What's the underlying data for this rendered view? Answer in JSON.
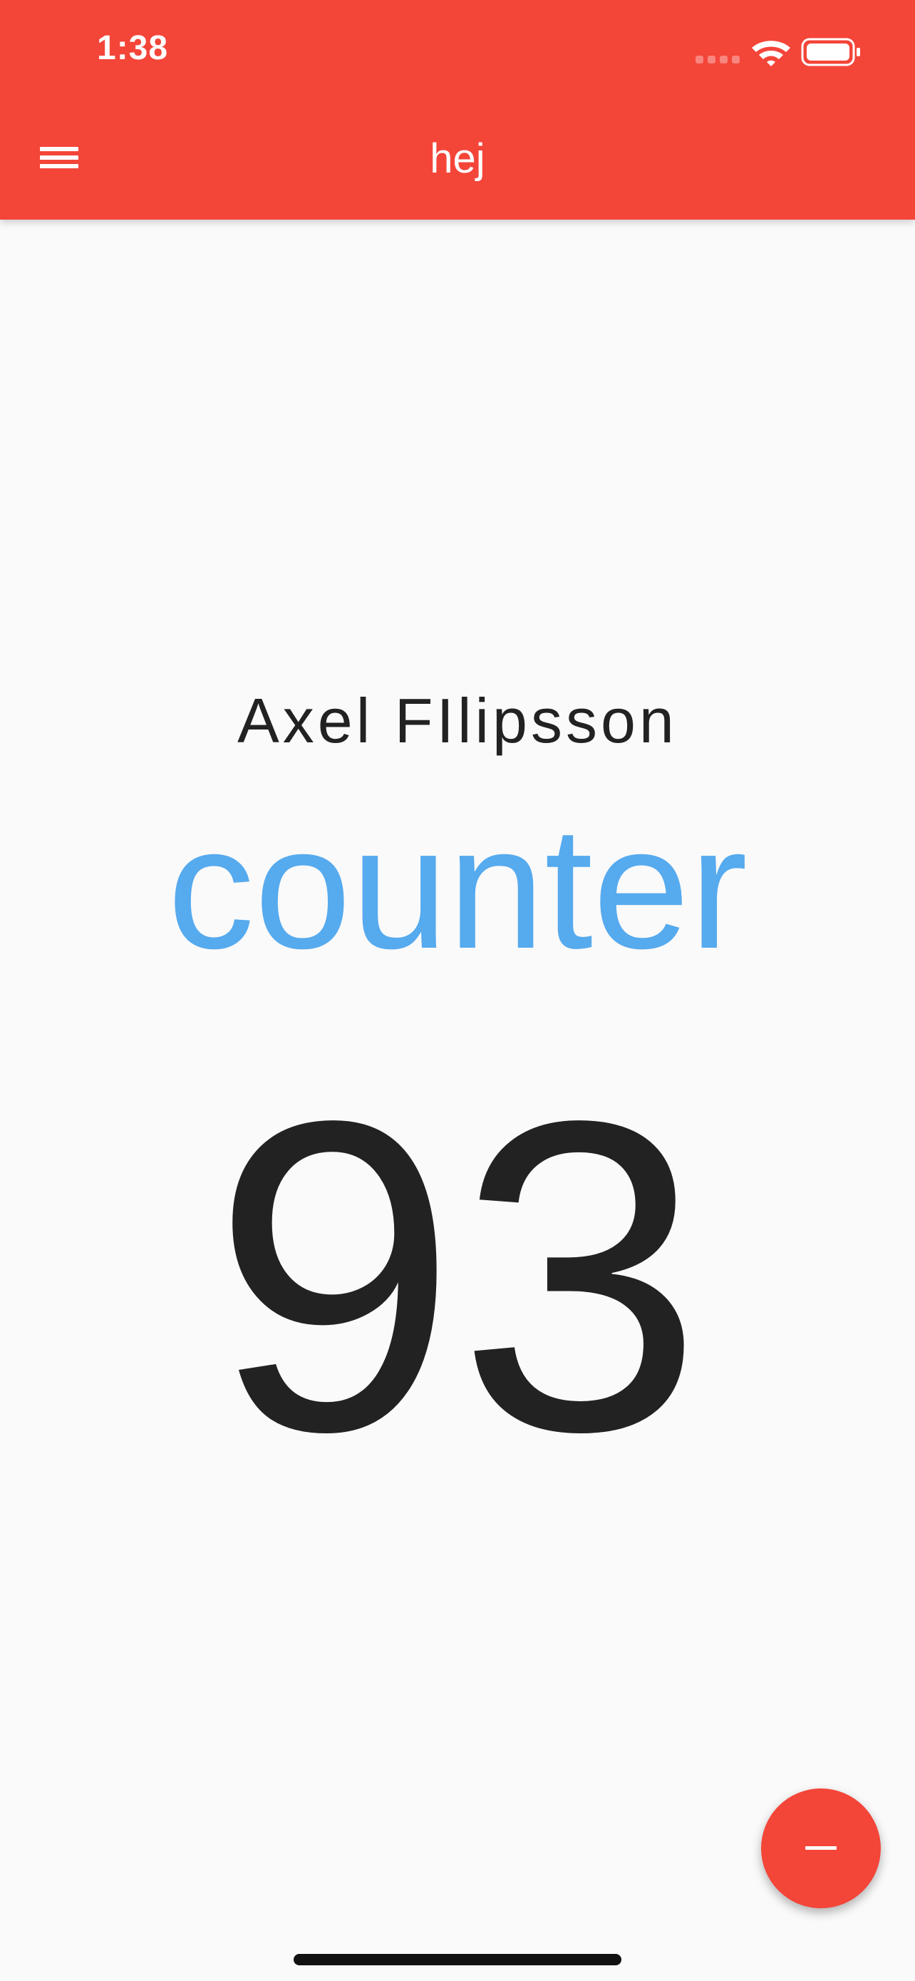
{
  "status_bar": {
    "time": "1:38",
    "icons": [
      "signal-icon",
      "wifi-icon",
      "battery-icon"
    ]
  },
  "app_bar": {
    "title": "hej",
    "menu_icon": "hamburger-menu-icon",
    "background_color": "#f44539"
  },
  "main": {
    "name": "Axel FIlipsson",
    "counter_label": "counter",
    "counter_value": "93",
    "counter_label_color": "#56aaee",
    "text_color": "#222222"
  },
  "fab": {
    "icon": "minus-icon",
    "color": "#f44539"
  }
}
